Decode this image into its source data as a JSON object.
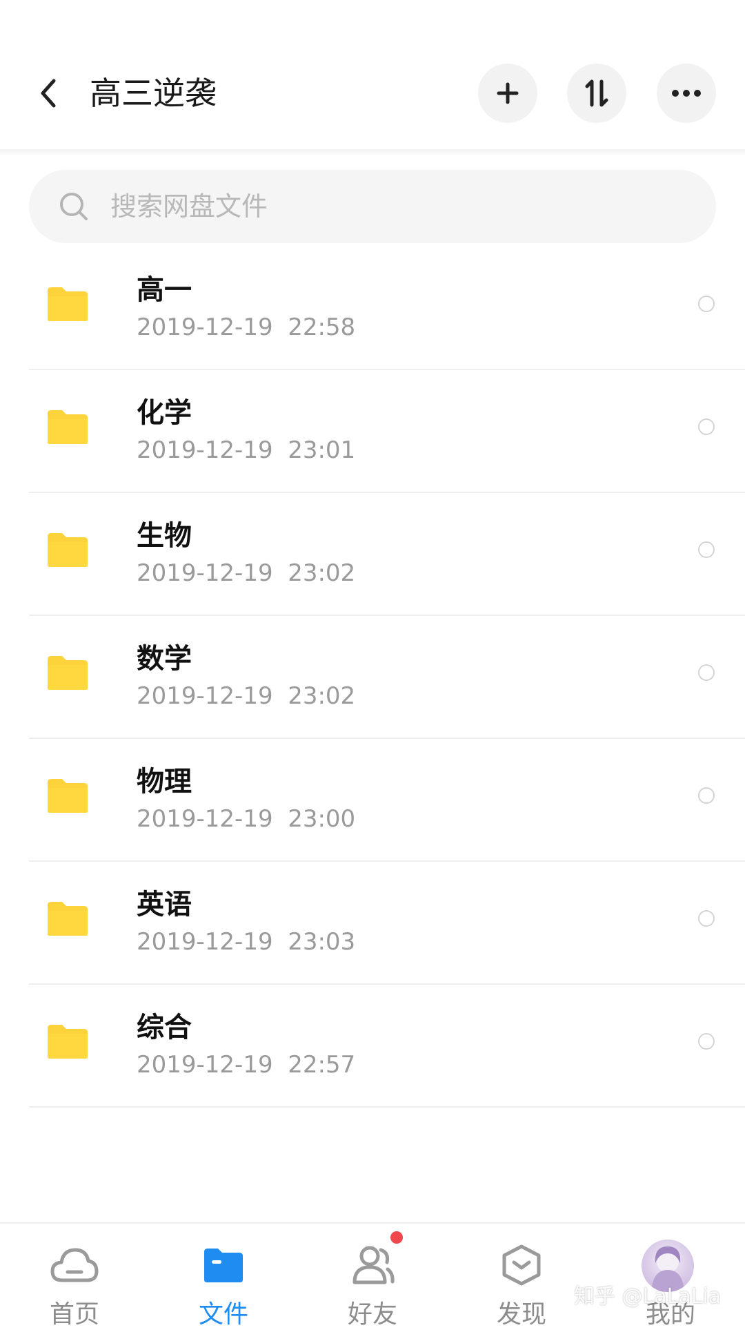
{
  "header": {
    "title": "高三逆袭"
  },
  "search": {
    "placeholder": "搜索网盘文件"
  },
  "files": [
    {
      "name": "高一",
      "date": "2019-12-19  22:58"
    },
    {
      "name": "化学",
      "date": "2019-12-19  23:01"
    },
    {
      "name": "生物",
      "date": "2019-12-19  23:02"
    },
    {
      "name": "数学",
      "date": "2019-12-19  23:02"
    },
    {
      "name": "物理",
      "date": "2019-12-19  23:00"
    },
    {
      "name": "英语",
      "date": "2019-12-19  23:03"
    },
    {
      "name": "综合",
      "date": "2019-12-19  22:57"
    }
  ],
  "nav": {
    "items": [
      {
        "label": "首页",
        "icon": "cloud-icon"
      },
      {
        "label": "文件",
        "icon": "folder-icon",
        "active": true
      },
      {
        "label": "好友",
        "icon": "friends-icon",
        "badge": true
      },
      {
        "label": "发现",
        "icon": "discover-icon"
      },
      {
        "label": "我的",
        "icon": "avatar"
      }
    ]
  },
  "watermark": "知乎 @LaLaLia",
  "colors": {
    "accent": "#1e8cf0",
    "folder": "#fdd33b",
    "badge": "#f0474c"
  }
}
